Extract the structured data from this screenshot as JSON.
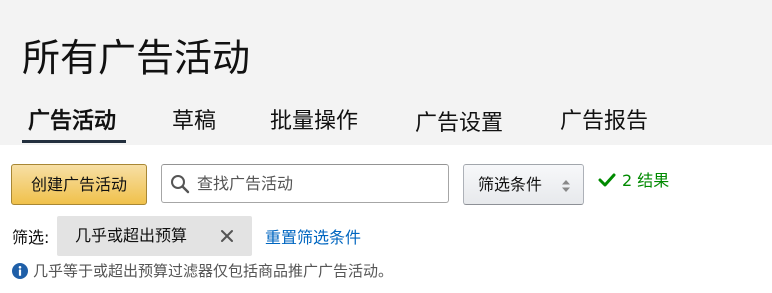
{
  "page": {
    "title": "所有广告活动"
  },
  "tabs": [
    {
      "label": "广告活动",
      "active": true
    },
    {
      "label": "草稿",
      "active": false
    },
    {
      "label": "批量操作",
      "active": false
    },
    {
      "label": "广告设置",
      "active": false
    },
    {
      "label": "广告报告",
      "active": false
    }
  ],
  "toolbar": {
    "create_button_label": "创建广告活动",
    "search": {
      "placeholder": "查找广告活动",
      "value": ""
    },
    "filter_select_label": "筛选条件",
    "results_text": "2 结果"
  },
  "filters": {
    "label": "筛选:",
    "active_chip_label": "几乎或超出预算",
    "reset_link_label": "重置筛选条件"
  },
  "info": {
    "text": "几乎等于或超出预算过滤器仅包括商品推广广告活动。"
  },
  "icons": {
    "search": "search-icon",
    "sort": "sort-icon",
    "check": "check-icon",
    "close": "close-icon",
    "info": "info-icon"
  },
  "colors": {
    "header_bg": "#f3f3f3",
    "primary_button_bg": "#f0c14b",
    "success_green": "#008a00",
    "link_blue": "#0066c0",
    "chip_bg": "#e3e3e3",
    "info_icon": "#1f5fa8"
  }
}
